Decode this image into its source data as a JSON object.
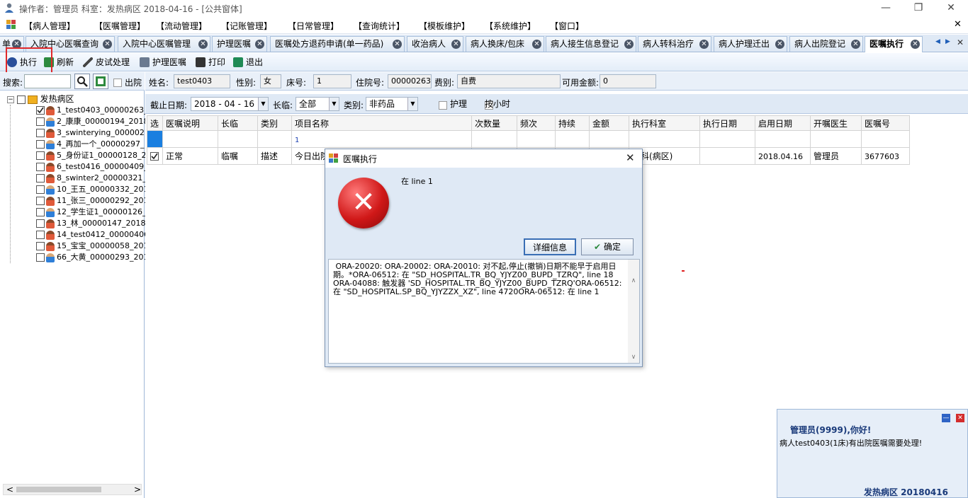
{
  "window": {
    "title": "操作者：管理员  科室：发热病区  2018-04-16 - [公共窗体]",
    "minimize": "—",
    "restore": "❐",
    "close": "✕"
  },
  "menu": [
    "【病人管理】",
    "【医嘱管理】",
    "【流动管理】",
    "【记账管理】",
    "【日常管理】",
    "【查询统计】",
    "【模板维护】",
    "【系统维护】",
    "【窗口】"
  ],
  "menu_close": "✕",
  "tabs": [
    "单",
    "入院中心医嘱查询",
    "入院中心医嘱管理",
    "护理医嘱",
    "医嘱处方退药申请(单一药品)",
    "收治病人",
    "病人换床/包床",
    "病人接生信息登记",
    "病人转科治疗",
    "病人护理迁出",
    "病人出院登记",
    "医嘱执行"
  ],
  "tab_close": "✕",
  "tab_nav": {
    "left": "◀",
    "right": "▶",
    "close": "✕"
  },
  "toolbar": {
    "execute": "执行",
    "refresh": "刷新",
    "skin_test": "皮试处理",
    "nursing_order": "护理医嘱",
    "print": "打印",
    "exit": "退出"
  },
  "search": {
    "label": "搜索:",
    "value": "",
    "discharge_label": "出院"
  },
  "tree": {
    "root": "发热病区",
    "collapse_icon": "−",
    "patients": [
      {
        "label": "1_test0403_00000263_",
        "checked": true,
        "sex": "f"
      },
      {
        "label": "2_康康_00000194_2018",
        "checked": false,
        "sex": "m"
      },
      {
        "label": "3_swinterying_000002",
        "checked": false,
        "sex": "f"
      },
      {
        "label": "4_再加一个_00000297_",
        "checked": false,
        "sex": "m"
      },
      {
        "label": "5_身份证1_00000128_2",
        "checked": false,
        "sex": "f"
      },
      {
        "label": "6_test0416_00000409_",
        "checked": false,
        "sex": "f"
      },
      {
        "label": "8_swinter2_00000321_",
        "checked": false,
        "sex": "f"
      },
      {
        "label": "10_王五_00000332_201",
        "checked": false,
        "sex": "m"
      },
      {
        "label": "11_张三_00000292_201",
        "checked": false,
        "sex": "f"
      },
      {
        "label": "12_学生证1_00000126_",
        "checked": false,
        "sex": "m"
      },
      {
        "label": "13_林_00000147_20180",
        "checked": false,
        "sex": "f"
      },
      {
        "label": "14_test0412_00000406",
        "checked": false,
        "sex": "f"
      },
      {
        "label": "15_宝宝_00000058_201",
        "checked": false,
        "sex": "f"
      },
      {
        "label": "66_大黄_00000293_201",
        "checked": false,
        "sex": "m"
      }
    ],
    "scroll_left": "<",
    "scroll_right": ">"
  },
  "patient": {
    "name_label": "姓名:",
    "name": "test0403",
    "sex_label": "性别:",
    "sex": "女",
    "bed_label": "床号:",
    "bed": "1",
    "inpatient_label": "住院号:",
    "inpatient_no": "00000263",
    "fee_label": "费别:",
    "fee_type": "自费",
    "balance_label": "可用金额:",
    "balance": "0"
  },
  "filters": {
    "deadline_label": "截止日期:",
    "deadline": "2018 - 04 - 16",
    "long_temp_label": "长临:",
    "long_temp": "全部",
    "category_label": "类别:",
    "category": "非药品",
    "nursing_label": "护理",
    "hourly_label": "按小时",
    "dropdown": "▼"
  },
  "grid": {
    "columns": [
      "选",
      "医嘱说明",
      "长临",
      "类别",
      "项目名称",
      "次数量",
      "频次",
      "持续",
      "金额",
      "执行科室",
      "执行日期",
      "启用日期",
      "开嘱医生",
      "医嘱号"
    ],
    "rows": [
      [
        "",
        "",
        "",
        "",
        "1",
        "",
        "",
        "",
        "",
        "",
        "",
        "",
        "",
        ""
      ],
      [
        "",
        "正常",
        "临嘱",
        "描述",
        "今日出院",
        "",
        "",
        "",
        "",
        "诊科(病区)",
        "",
        "2018.04.16",
        "管理员",
        "3677603"
      ]
    ]
  },
  "dialog": {
    "title": "医嘱执行",
    "close": "✕",
    "error_icon": "✕",
    "short_message": "在 line 1",
    "details_button": "详细信息",
    "ok_button": "确定",
    "ok_icon": "✔",
    "detail_text": " ORA-20020: ORA-20002: ORA-20010: 对不起,停止(撤销)日期不能早于启用日期。*ORA-06512: 在 \"SD_HOSPITAL.TR_BQ_YJYZ00_BUPD_TZRQ\", line 18\nORA-04088: 触发器 'SD_HOSPITAL.TR_BQ_YJYZ00_BUPD_TZRQ'ORA-06512: 在 \"SD_HOSPITAL.SP_BQ_YJYZZX_XZ\", line 4720ORA-06512: 在 line 1",
    "scroll_up": "∧",
    "scroll_down": "∨"
  },
  "notification": {
    "greeting": "管理员(9999),你好!",
    "message": "病人test0403(1床)有出院医嘱需要处理!",
    "footer": "发热病区  20180416",
    "minimize": "—",
    "close": "✕"
  }
}
